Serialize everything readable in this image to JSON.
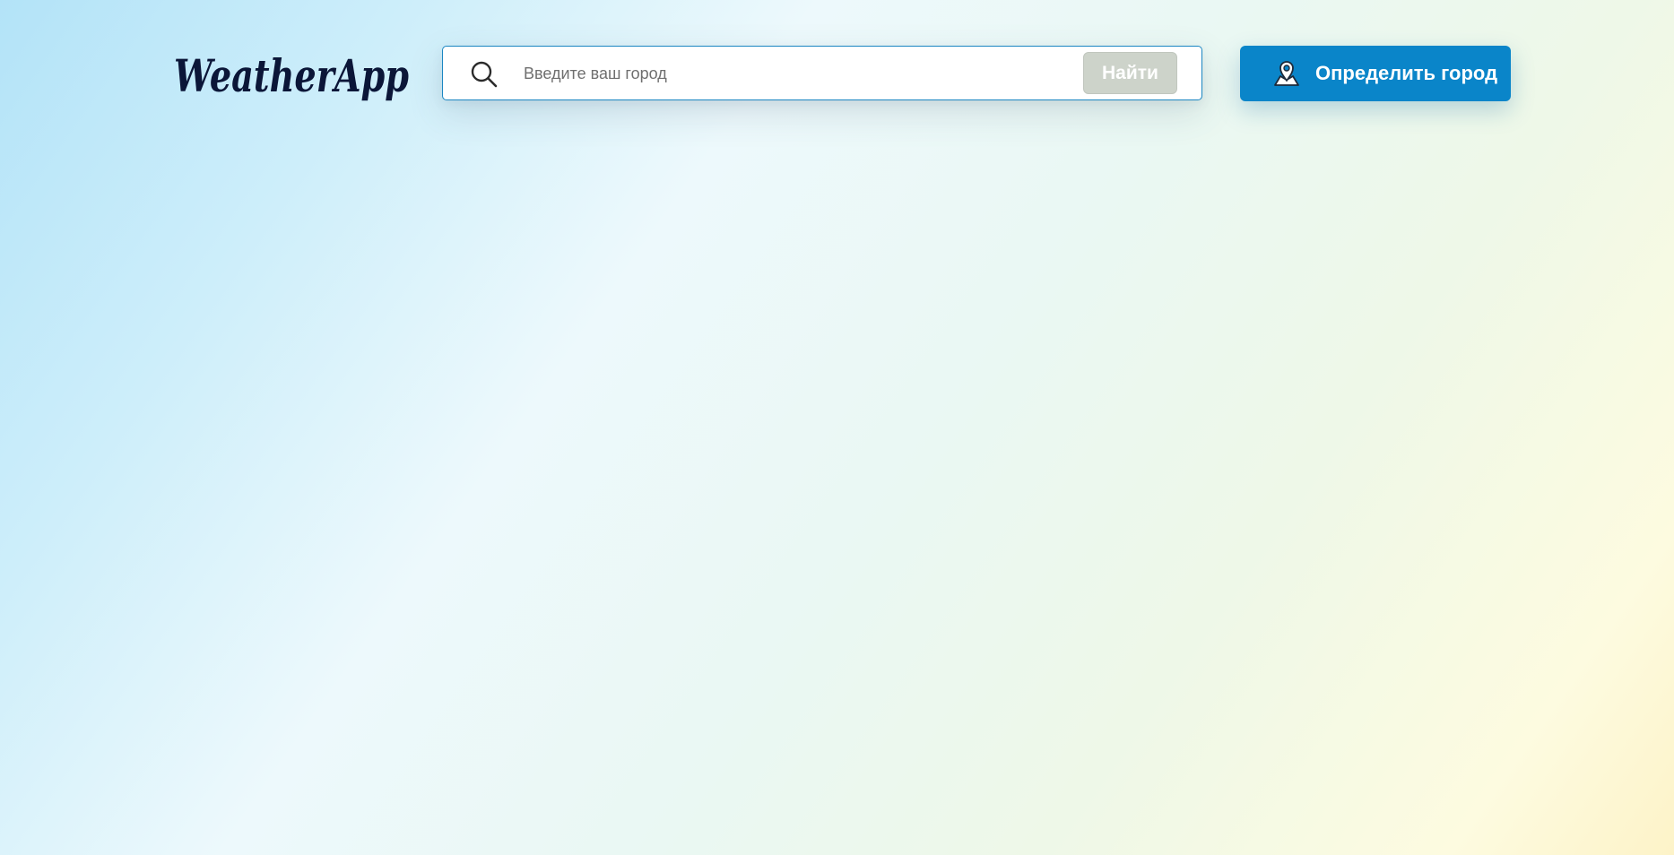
{
  "header": {
    "logo_text": "WeatherApp",
    "logo_colors": {
      "weather": "#0b1638",
      "app": "#0d3f7e"
    }
  },
  "search": {
    "icon": "search-icon",
    "placeholder": "Введите ваш город",
    "value": "",
    "button_label": "Найти",
    "button_color": "#cdd3ca"
  },
  "locate": {
    "icon": "location-person-icon",
    "label": "Определить город",
    "color": "#0a85c9"
  }
}
